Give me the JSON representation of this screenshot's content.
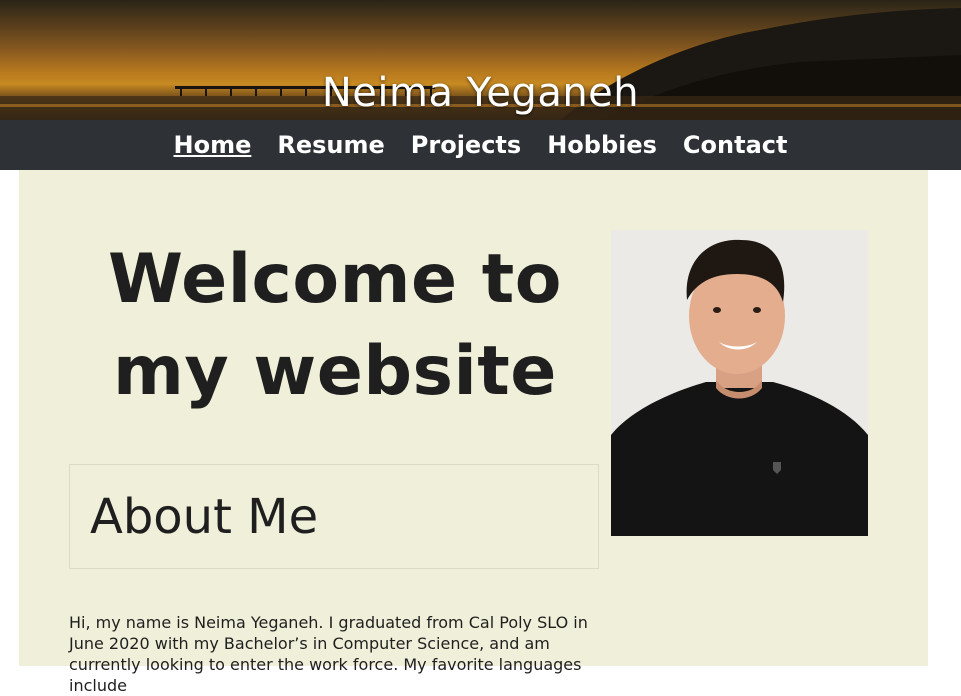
{
  "header": {
    "site_title": "Neima Yeganeh"
  },
  "nav": {
    "items": [
      {
        "label": "Home",
        "active": true
      },
      {
        "label": "Resume",
        "active": false
      },
      {
        "label": "Projects",
        "active": false
      },
      {
        "label": "Hobbies",
        "active": false
      },
      {
        "label": "Contact",
        "active": false
      }
    ]
  },
  "main": {
    "welcome_line1": "Welcome to",
    "welcome_line2": "my website",
    "about_title": "About Me",
    "intro_text": "Hi, my name is Neima Yeganeh. I graduated from Cal Poly SLO in June 2020 with my Bachelor’s in Computer Science, and am currently looking to enter the work force. My favorite languages include"
  },
  "colors": {
    "nav_bg": "#2e3236",
    "content_bg": "#f0efd9",
    "text": "#1f1f1f"
  }
}
